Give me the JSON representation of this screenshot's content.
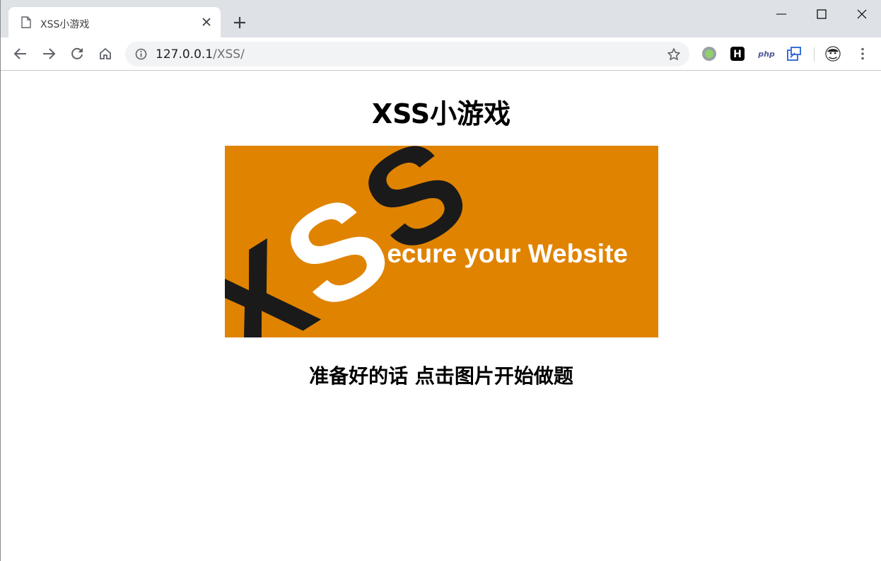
{
  "browser": {
    "tab": {
      "title": "XSS小游戏"
    },
    "address_bar": {
      "host": "127.0.0.1",
      "path": "/XSS/"
    },
    "extensions": [
      "green-dot-icon",
      "h-icon",
      "php-icon",
      "tab-icon",
      "avatar-icon"
    ]
  },
  "page": {
    "title": "XSS小游戏",
    "banner": {
      "logo_text": "XSS",
      "slogan": "ecure your Website",
      "colors": {
        "background": "#e08300",
        "dark": "#1a1a1a",
        "light": "#ffffff"
      }
    },
    "subtitle": "准备好的话 点击图片开始做题"
  },
  "ext_labels": {
    "h": "H",
    "php": "php"
  }
}
